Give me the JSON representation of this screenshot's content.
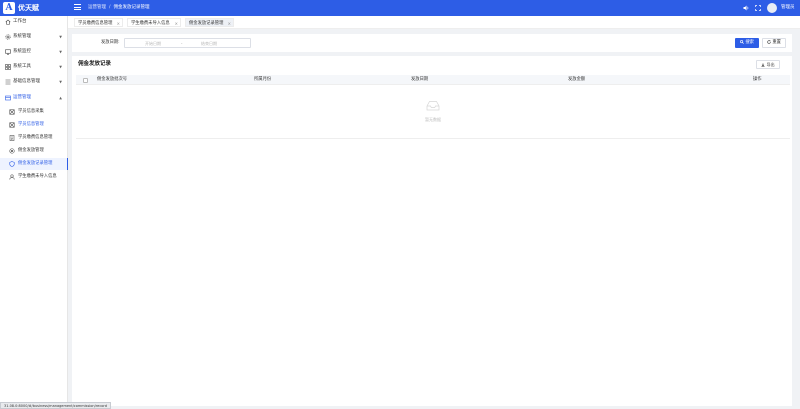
{
  "app": {
    "logo_letter": "A",
    "name": "优天赋"
  },
  "header": {
    "breadcrumb": [
      "运营管理",
      "佣金发放记录管理"
    ],
    "username": "管理员",
    "icons": [
      "menu-icon",
      "volume-icon",
      "fullscreen-icon",
      "close-icon"
    ]
  },
  "sidebar": {
    "items": [
      {
        "label": "工作台",
        "icon": "home-icon"
      },
      {
        "label": "系统管理",
        "icon": "gear-icon"
      },
      {
        "label": "系统监控",
        "icon": "monitor-icon"
      },
      {
        "label": "系统工具",
        "icon": "grid-icon"
      },
      {
        "label": "基础信息管理",
        "icon": "list-icon"
      },
      {
        "label": "运营管理",
        "icon": "card-icon"
      }
    ],
    "sub_items": [
      {
        "label": "学员信息采集",
        "icon": "box-icon"
      },
      {
        "label": "学员信息管理",
        "icon": "box-icon"
      },
      {
        "label": "学员缴费信息管理",
        "icon": "document-icon"
      },
      {
        "label": "佣金发放管理",
        "icon": "circle-icon"
      },
      {
        "label": "佣金发放记录管理",
        "icon": "shield-icon"
      },
      {
        "label": "学生缴费未导入信息",
        "icon": "user-icon"
      }
    ]
  },
  "tabs": [
    {
      "label": "学员缴费信息管理"
    },
    {
      "label": "学生缴费未导入信息"
    },
    {
      "label": "佣金发放记录管理"
    }
  ],
  "search": {
    "label": "发放日期:",
    "start_placeholder": "开始日期",
    "separator": "-",
    "end_placeholder": "结束日期",
    "search_button": "搜索",
    "reset_button": "重置"
  },
  "table": {
    "title": "佣金发放记录",
    "export_button": "导出",
    "columns": [
      "佣金发放批次号",
      "所属月份",
      "发放日期",
      "发放金额",
      "操作"
    ],
    "rows": [],
    "empty_text": "暂无数据"
  },
  "statusbar": {
    "url": "31.08.0:8000/#/business/management/commission/record"
  }
}
